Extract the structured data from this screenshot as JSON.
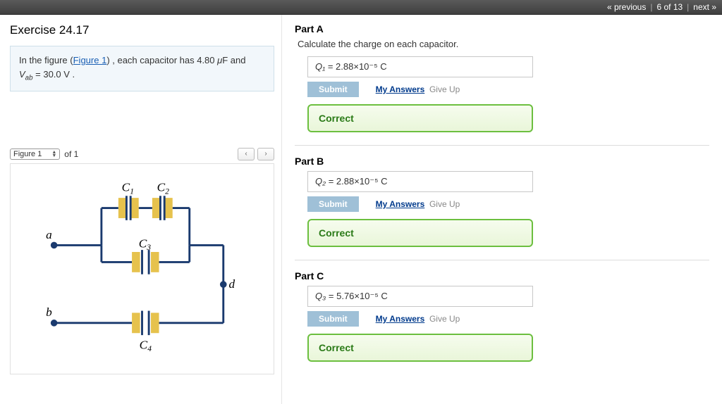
{
  "nav": {
    "prev": "« previous",
    "position": "6 of 13",
    "next": "next »"
  },
  "exercise": {
    "title": "Exercise 24.17",
    "statement_pre": "In the figure (",
    "figure_link": "Figure 1",
    "statement_post": ") , each capacitor has 4.80 μF and Vab = 30.0 V .",
    "capacitance_uF": 4.8,
    "Vab_V": 30.0
  },
  "figure": {
    "selector_label": "Figure 1",
    "count_text": "of 1",
    "labels": {
      "C1": "C₁",
      "C2": "C₂",
      "C3": "C₃",
      "C4": "C₄",
      "a": "a",
      "b": "b",
      "d": "d"
    }
  },
  "partA": {
    "title": "Part A",
    "instruction": "Calculate the charge on each capacitor.",
    "var": "Q₁",
    "equals": " = ",
    "value": "2.88×10⁻⁵",
    "unit": "  C",
    "submit": "Submit",
    "my_answers": "My Answers",
    "give_up": "Give Up",
    "feedback": "Correct"
  },
  "partB": {
    "title": "Part B",
    "var": "Q₂",
    "equals": " = ",
    "value": "2.88×10⁻⁵",
    "unit": "  C",
    "submit": "Submit",
    "my_answers": "My Answers",
    "give_up": "Give Up",
    "feedback": "Correct"
  },
  "partC": {
    "title": "Part C",
    "var": "Q₃",
    "equals": " = ",
    "value": "5.76×10⁻⁵",
    "unit": "  C",
    "submit": "Submit",
    "my_answers": "My Answers",
    "give_up": "Give Up",
    "feedback": "Correct"
  }
}
